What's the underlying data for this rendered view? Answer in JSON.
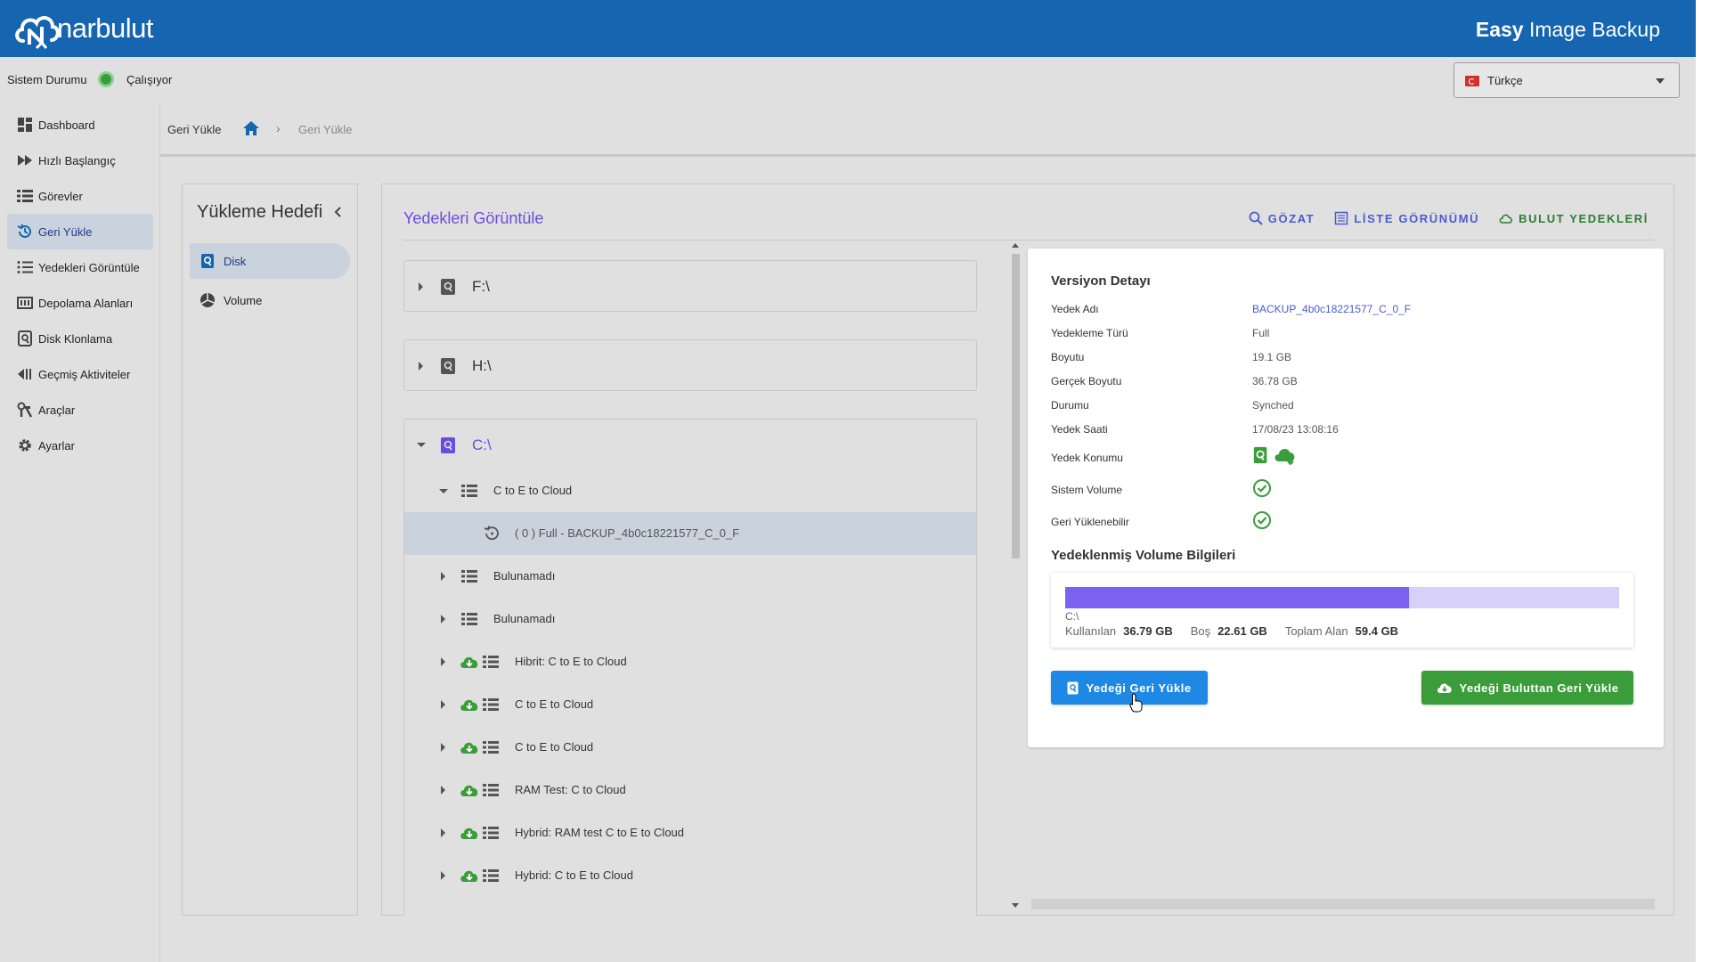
{
  "brand": {
    "logo_text": "narbulut",
    "app_title_bold": "Easy",
    "app_title_rest": " Image Backup"
  },
  "status": {
    "label": "Sistem Durumu",
    "value": "Çalışıyor",
    "color": "#3a9d3a"
  },
  "language": {
    "selected": "Türkçe",
    "flag": "turkey-flag"
  },
  "sidebar": {
    "items": [
      {
        "label": "Dashboard",
        "icon": "dashboard-icon"
      },
      {
        "label": "Hızlı Başlangıç",
        "icon": "fast-forward-icon"
      },
      {
        "label": "Görevler",
        "icon": "list-icon"
      },
      {
        "label": "Geri Yükle",
        "icon": "restore-icon",
        "active": true
      },
      {
        "label": "Yedekleri Görüntüle",
        "icon": "list-view-icon"
      },
      {
        "label": "Depolama Alanları",
        "icon": "storage-icon"
      },
      {
        "label": "Disk Klonlama",
        "icon": "disk-clone-icon"
      },
      {
        "label": "Geçmiş Aktiviteler",
        "icon": "history-icon"
      },
      {
        "label": "Araçlar",
        "icon": "tools-icon"
      },
      {
        "label": "Ayarlar",
        "icon": "gear-icon"
      }
    ]
  },
  "breadcrumb": {
    "root": "Geri Yükle",
    "separator": "›",
    "current": "Geri Yükle"
  },
  "target_panel": {
    "title": "Yükleme Hedefi",
    "items": [
      {
        "label": "Disk",
        "icon": "disk-icon",
        "active": true
      },
      {
        "label": "Volume",
        "icon": "pie-chart-icon"
      }
    ]
  },
  "viewer": {
    "title": "Yedekleri Görüntüle",
    "toolbar": {
      "browse": "GÖZAT",
      "list_view": "LİSTE GÖRÜNÜMÜ",
      "cloud_backups": "BULUT YEDEKLERİ"
    }
  },
  "tree": {
    "drives": [
      {
        "label": "F:\\",
        "expanded": false
      },
      {
        "label": "H:\\",
        "expanded": false
      },
      {
        "label": "C:\\",
        "expanded": true
      }
    ],
    "c_rows": [
      {
        "label": "C to E to Cloud",
        "expanded": true,
        "cloud": false
      },
      {
        "label": "( 0 ) Full - BACKUP_4b0c18221577_C_0_F",
        "version": true
      },
      {
        "label": "Bulunamadı",
        "cloud": false
      },
      {
        "label": "Bulunamadı",
        "cloud": false
      },
      {
        "label": "Hibrit: C to E to Cloud",
        "cloud": true
      },
      {
        "label": "C to E to Cloud",
        "cloud": true
      },
      {
        "label": "C to E to Cloud",
        "cloud": true
      },
      {
        "label": "RAM Test: C to Cloud",
        "cloud": true
      },
      {
        "label": "Hybrid: RAM test C to E to Cloud",
        "cloud": true
      },
      {
        "label": "Hybrid: C to E to Cloud",
        "cloud": true
      }
    ]
  },
  "detail": {
    "title": "Versiyon Detayı",
    "fields": [
      {
        "label": "Yedek Adı",
        "value": "BACKUP_4b0c18221577_C_0_F"
      },
      {
        "label": "Yedekleme Türü",
        "value": "Full"
      },
      {
        "label": "Boyutu",
        "value": "19.1 GB"
      },
      {
        "label": "Gerçek Boyutu",
        "value": "36.78 GB"
      },
      {
        "label": "Durumu",
        "value": "Synched"
      },
      {
        "label": "Yedek Saati",
        "value": "17/08/23 13:08:16"
      },
      {
        "label": "Yedek Konumu",
        "icons": [
          "local-disk-icon",
          "cloud-icon"
        ]
      },
      {
        "label": "Sistem Volume",
        "icons": [
          "check-circle-icon"
        ]
      },
      {
        "label": "Geri Yüklenebilir",
        "icons": [
          "check-circle-icon"
        ]
      }
    ],
    "volume": {
      "title": "Yedeklenmiş Volume Bilgileri",
      "drive": "C:\\",
      "used_label": "Kullanılan",
      "used": "36.79 GB",
      "free_label": "Boş",
      "free": "22.61 GB",
      "total_label": "Toplam Alan",
      "total": "59.4 GB",
      "used_fraction": 0.62
    },
    "buttons": {
      "restore": "Yedeği Geri Yükle",
      "restore_cloud": "Yedeği Buluttan Geri Yükle"
    }
  },
  "colors": {
    "header": "#1565b0",
    "accent_purple": "#6b4ce0",
    "green": "#3a9d3a",
    "blue_button": "#1e88e5"
  }
}
